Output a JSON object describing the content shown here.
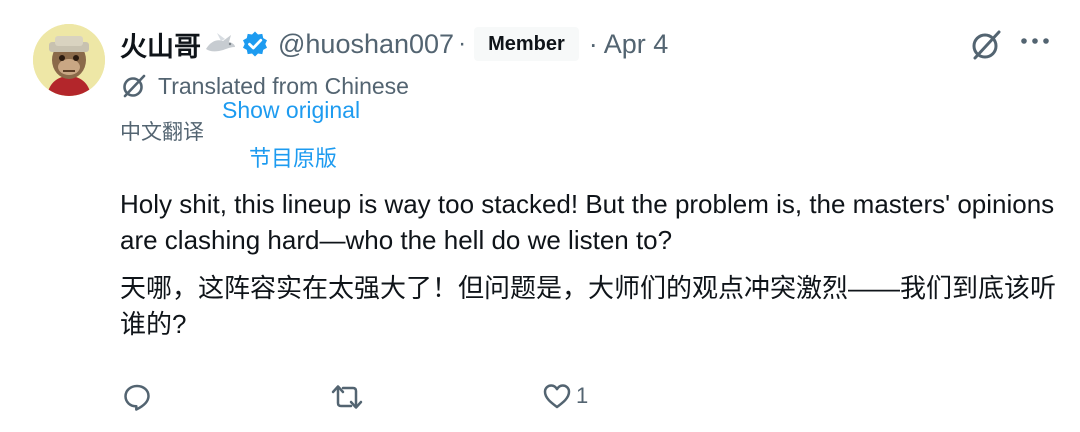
{
  "author": {
    "display_name": "火山哥",
    "handle": "@huoshan007",
    "separator": "·",
    "badge": "Member",
    "date": "· Apr 4",
    "avatar_icon": "ape-avatar",
    "verified_icon": "verified-badge-icon"
  },
  "translation": {
    "notice": "Translated from Chinese",
    "language_label": "中文翻译",
    "show_original": "Show original",
    "original_label": "节目原版"
  },
  "tweet": {
    "text_en": "Holy shit, this lineup is way too stacked! But the problem is, the masters' opinions are clashing hard—who the hell do we listen to?",
    "text_zh": "天哪，这阵容实在太强大了！但问题是，大师们的观点冲突激烈——我们到底该听谁的?"
  },
  "actions": {
    "reply_count": "",
    "repost_count": "",
    "like_count": "1"
  },
  "colors": {
    "accent": "#1d9bf0",
    "secondary_text": "#536471",
    "primary_text": "#0f1419"
  }
}
